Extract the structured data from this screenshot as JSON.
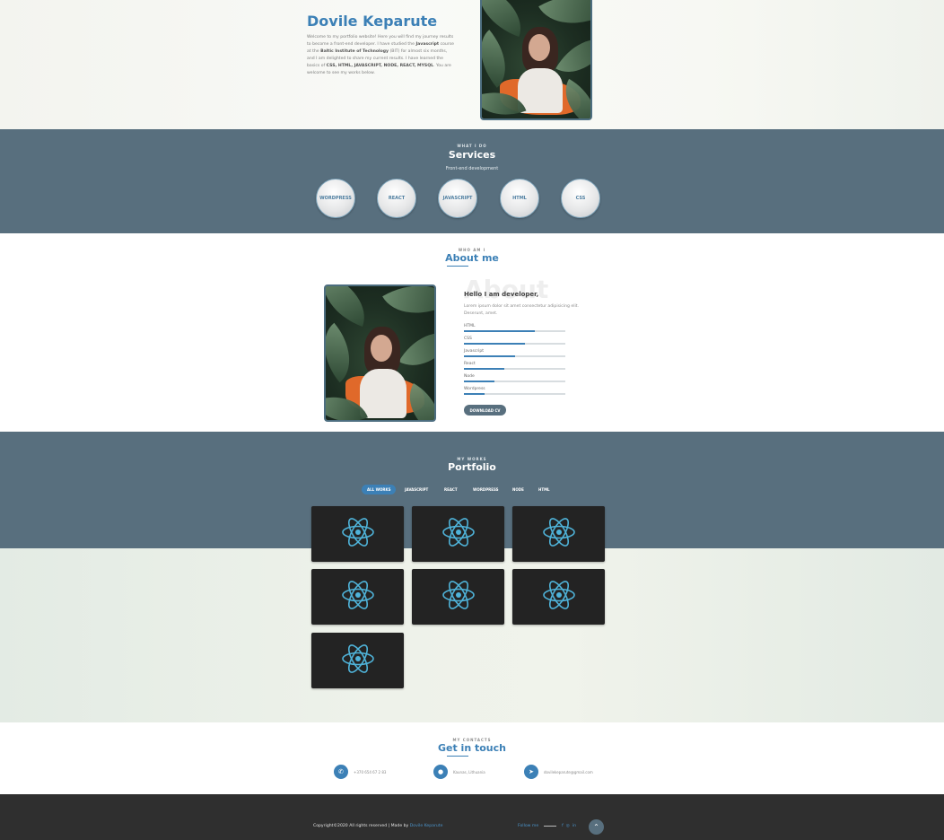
{
  "hero": {
    "name": "Dovile Keparute",
    "bio_parts": [
      "Welcome to my portfolio website! Here you will find my journey results to become a front-end developer. I have studied the ",
      "Javascript",
      " course at the ",
      "Baltic Institute of Technology",
      " (BIT) for almost six months, and I am delighted to share my current results. I have learned the basics of ",
      "CSS, HTML, JAVASCRIPT, NODE, REACT, MYSQL",
      ". You are welcome to see my works below."
    ]
  },
  "services": {
    "overline": "WHAT I DO",
    "title": "Services",
    "subtitle": "Front-end development",
    "items": [
      "WORDPRESS",
      "REACT",
      "JAVASCRIPT",
      "HTML",
      "CSS"
    ]
  },
  "about": {
    "overline": "WHO AM I",
    "title": "About me",
    "bg_word": "About",
    "hello": "Hello I am developer,",
    "text": "Lorem ipsum dolor sit amet consectetur adipisicing elit. Deserunt, amet.",
    "skills": [
      {
        "name": "HTML",
        "level": 0.7
      },
      {
        "name": "CSS",
        "level": 0.6
      },
      {
        "name": "Javascript",
        "level": 0.5
      },
      {
        "name": "React",
        "level": 0.4
      },
      {
        "name": "Node",
        "level": 0.3
      },
      {
        "name": "Wordpress",
        "level": 0.2
      }
    ],
    "cv_button": "DOWNLOAD CV"
  },
  "portfolio": {
    "overline": "MY WORKS",
    "title": "Portfolio",
    "filters": [
      "ALL WORKS",
      "JAVASCRIPT",
      "REACT",
      "WORDPRESS",
      "NODE",
      "HTML"
    ],
    "active_filter": "ALL WORKS",
    "card_icon": "react-logo-icon",
    "card_count": 7
  },
  "contact": {
    "overline": "MY CONTACTS",
    "title": "Get in touch",
    "items": [
      {
        "icon": "phone-icon",
        "text": "+370 654 67 2 83"
      },
      {
        "icon": "location-icon",
        "text": "Kaunas, Lithuania"
      },
      {
        "icon": "send-icon",
        "text": "dovilekeparute@gmail.com"
      }
    ]
  },
  "footer": {
    "copyright": "Copyright©2020 All rights reserved | Made by ",
    "author": "Dovile Keparute",
    "follow": "Follow me",
    "socials": [
      "f",
      "◎",
      "in"
    ]
  },
  "colors": {
    "accent": "#3c80b6",
    "slate": "#586f7e",
    "footer": "#2f2f2f"
  }
}
